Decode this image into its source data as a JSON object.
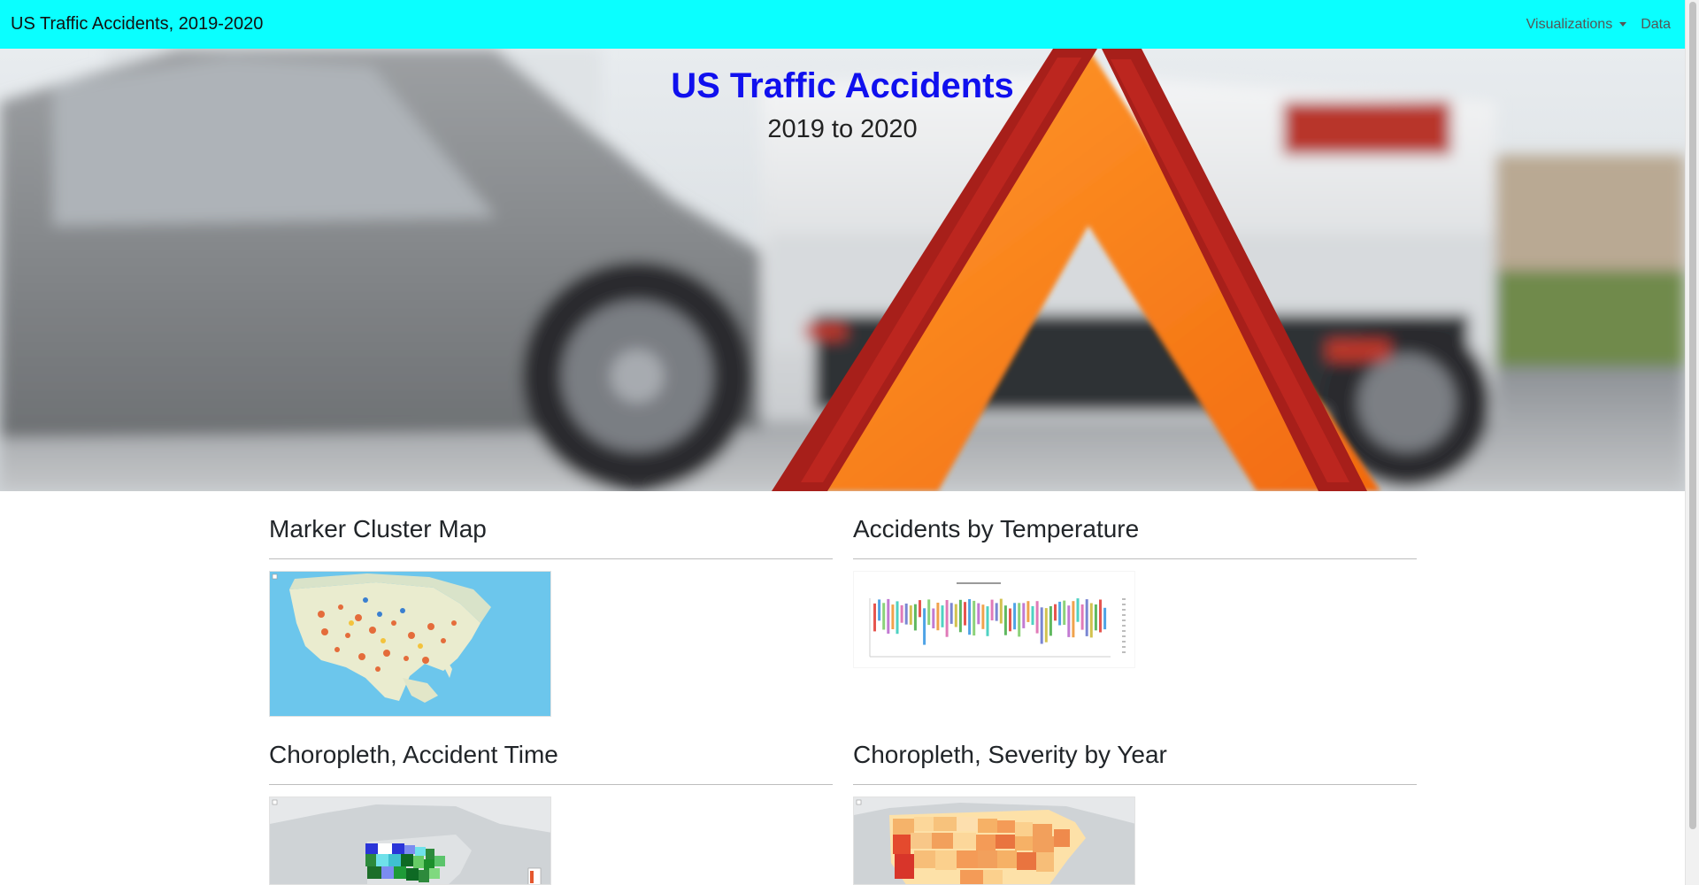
{
  "navbar": {
    "brand": "US Traffic Accidents, 2019-2020",
    "links": [
      {
        "label": "Visualizations",
        "dropdown": true
      },
      {
        "label": "Data",
        "dropdown": false
      }
    ],
    "background_color": "#0affff"
  },
  "hero": {
    "title": "US Traffic Accidents",
    "subtitle": "2019 to 2020",
    "title_color": "#1010ee"
  },
  "sections": [
    {
      "title": "Marker Cluster Map"
    },
    {
      "title": "Accidents by Temperature"
    },
    {
      "title": "Choropleth, Accident Time"
    },
    {
      "title": "Choropleth, Severity by Year"
    }
  ]
}
